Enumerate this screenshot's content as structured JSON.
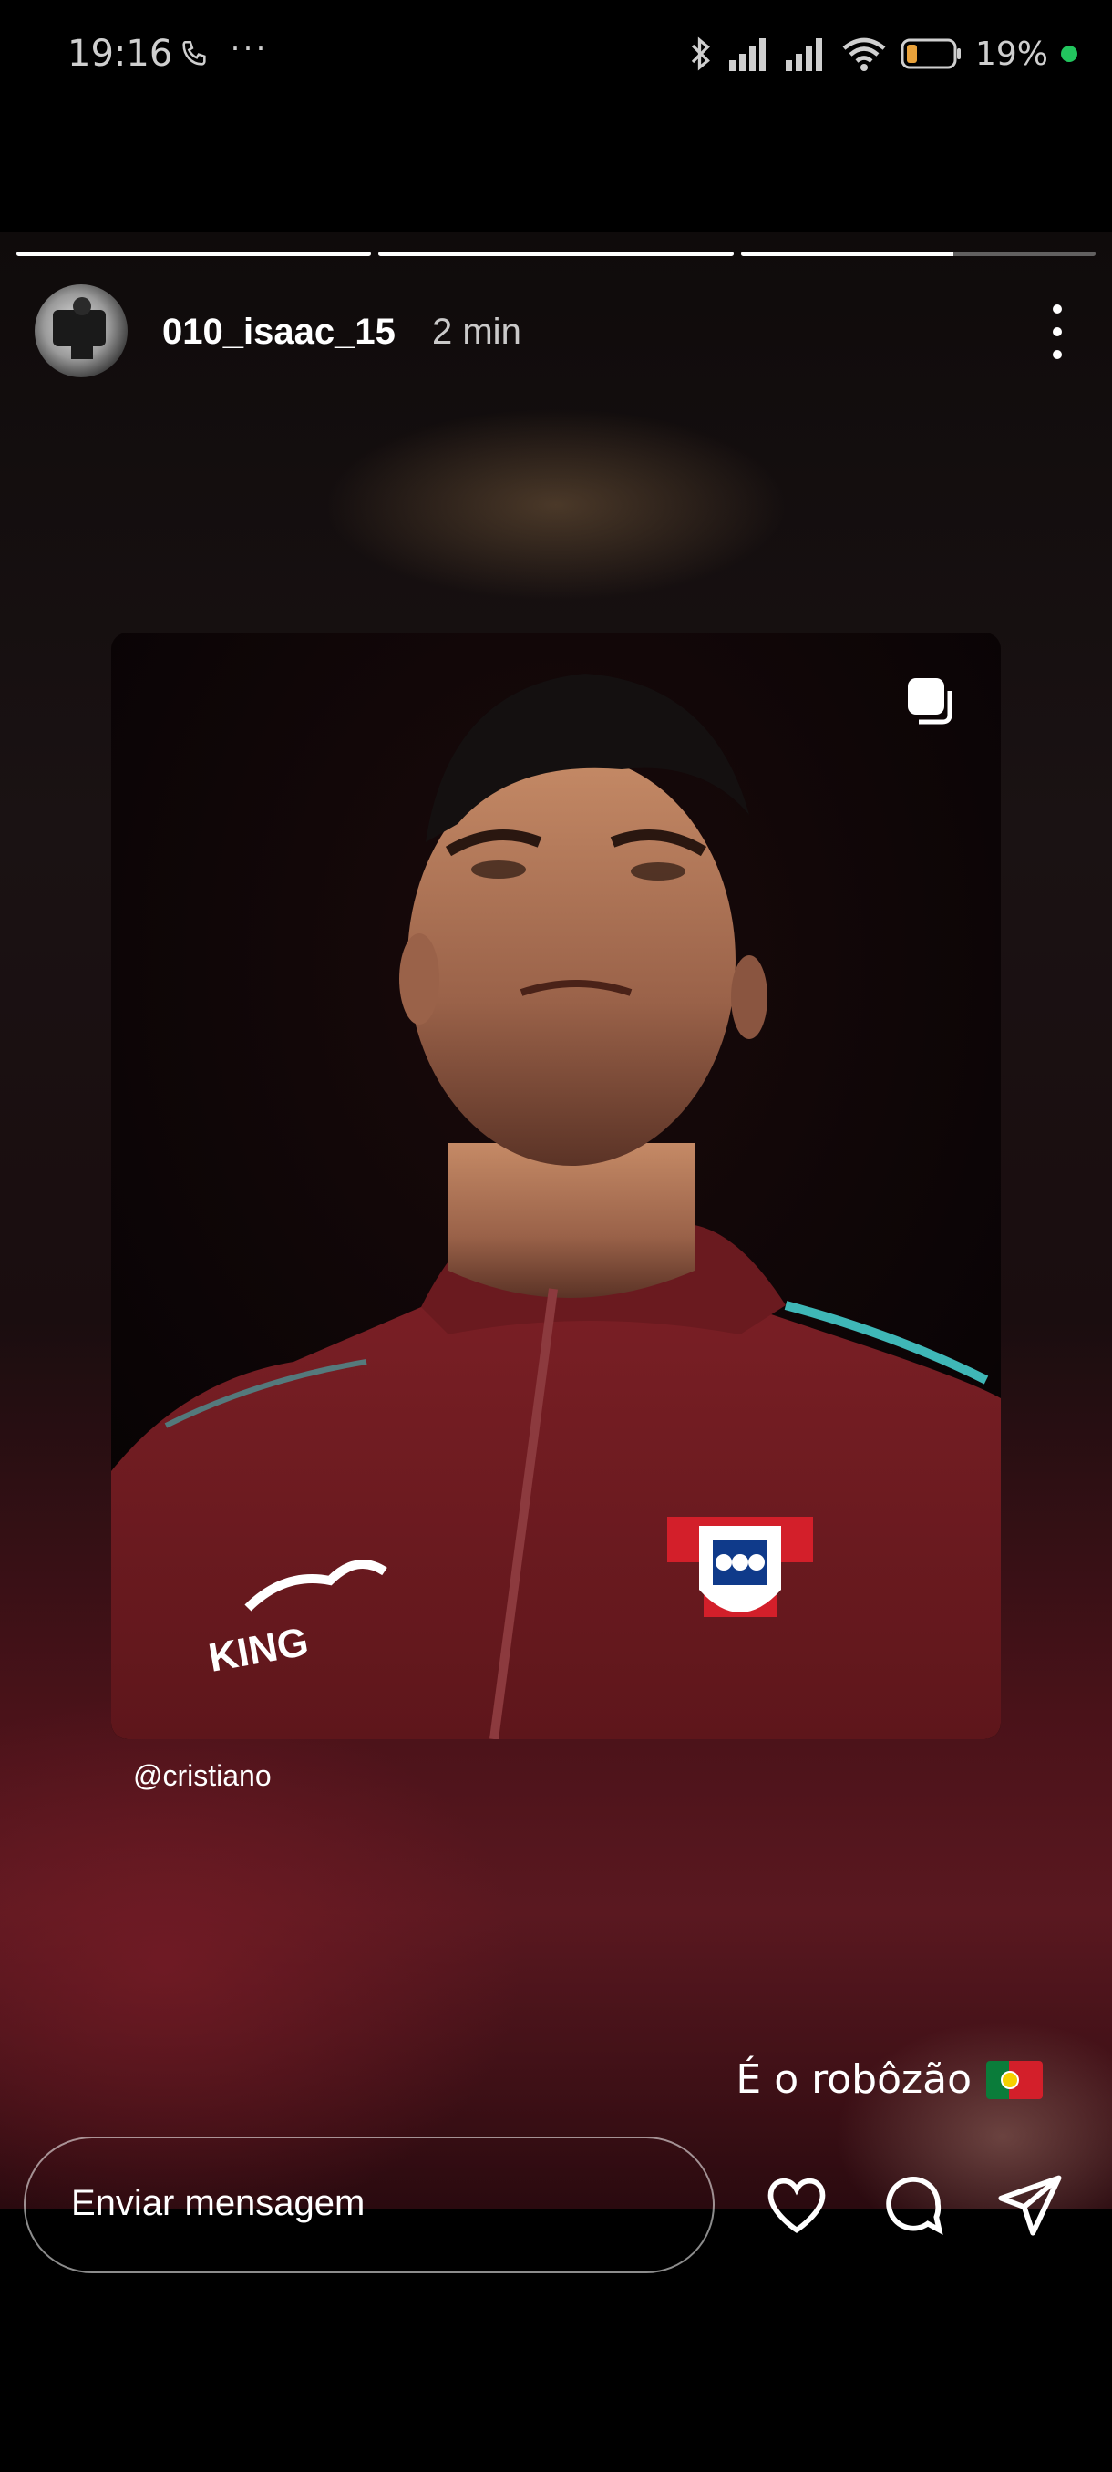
{
  "status_bar": {
    "time": "19:16",
    "battery": "19%",
    "icons": [
      "phone-icon",
      "more-dots-icon",
      "bluetooth-icon",
      "signal-icon",
      "signal-icon",
      "wifi-icon",
      "battery-icon"
    ]
  },
  "story": {
    "progress_fractions": [
      1,
      1,
      0.6
    ],
    "username": "010_isaac_15",
    "time_ago": "2 min",
    "mention": "@cristiano",
    "caption": "É o robôzão"
  },
  "post": {
    "badge_letters": "KING"
  },
  "reply": {
    "placeholder": "Enviar mensagem"
  },
  "colors": {
    "jacket": "#7a1f25",
    "accent_teal": "#3fb7b7",
    "flag_green": "#0a7c3a",
    "flag_red": "#d31f2a"
  }
}
